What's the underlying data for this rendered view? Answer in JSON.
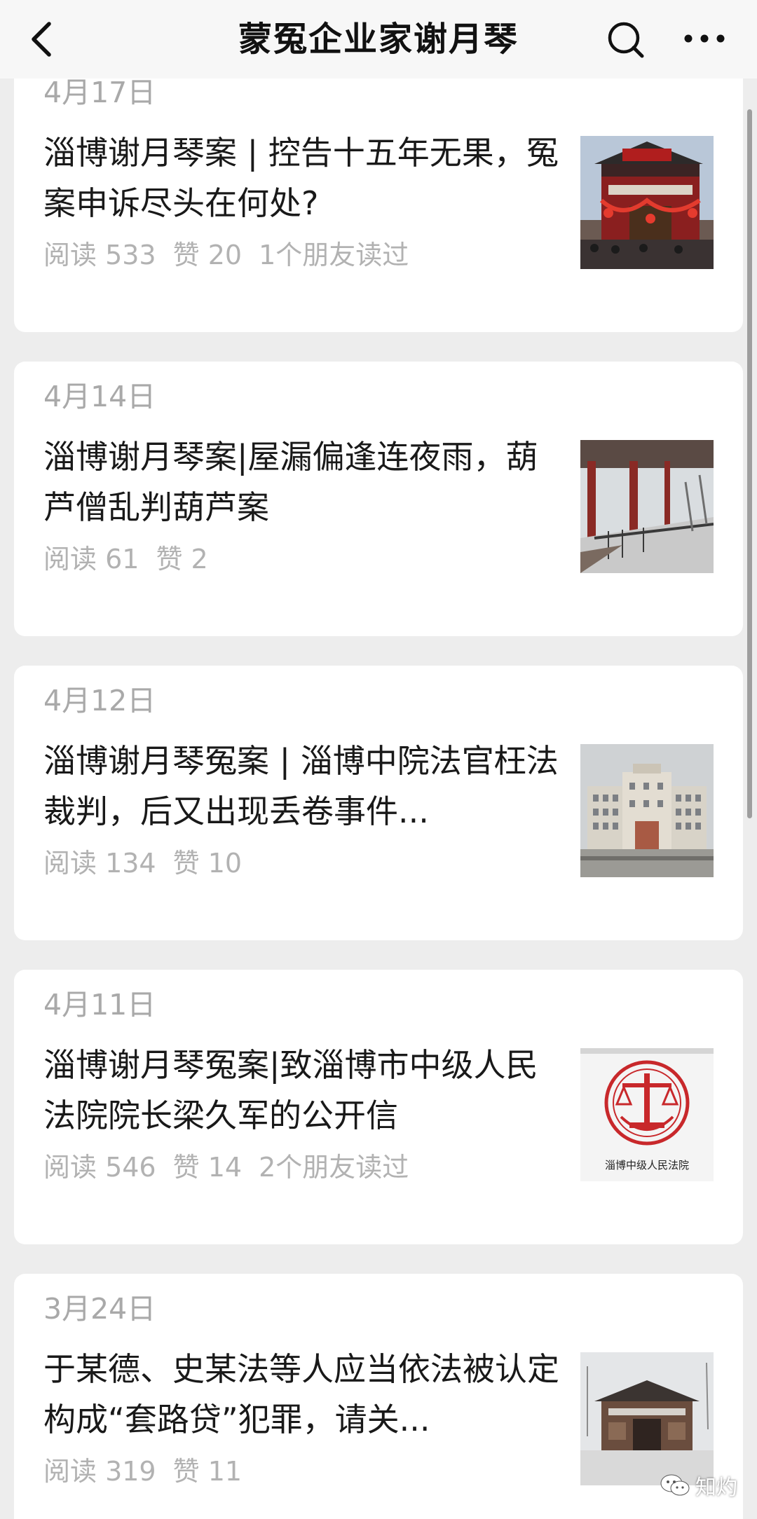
{
  "header": {
    "title": "蒙冤企业家谢月琴",
    "back_icon": "chevron-left-icon",
    "search_icon": "search-icon",
    "more_icon": "more-dots-icon"
  },
  "articles": [
    {
      "date": "4月17日",
      "title": "淄博谢月琴案 | 控告十五年无果，冤案申诉尽头在何处?",
      "reads": "阅读 533",
      "likes": "赞 20",
      "friends": "1个朋友读过",
      "thumb": "temple-gate-thumbnail"
    },
    {
      "date": "4月14日",
      "title": "淄博谢月琴案|屋漏偏逢连夜雨，葫芦僧乱判葫芦案",
      "reads": "阅读 61",
      "likes": "赞 2",
      "friends": "",
      "thumb": "snowy-corridor-thumbnail"
    },
    {
      "date": "4月12日",
      "title": "淄博谢月琴冤案 | 淄博中院法官枉法裁判，后又出现丢卷事件...",
      "reads": "阅读 134",
      "likes": "赞 10",
      "friends": "",
      "thumb": "court-building-thumbnail"
    },
    {
      "date": "4月11日",
      "title": "淄博谢月琴冤案|致淄博市中级人民法院院长梁久军的公开信",
      "reads": "阅读 546",
      "likes": "赞 14",
      "friends": "2个朋友读过",
      "thumb": "court-emblem-thumbnail",
      "thumb_caption": "淄博中级人民法院"
    },
    {
      "date": "3月24日",
      "title": "于某德、史某法等人应当依法被认定构成“套路贷”犯罪，请关...",
      "reads": "阅读 319",
      "likes": "赞 11",
      "friends": "",
      "thumb": "old-building-thumbnail"
    }
  ],
  "watermark": {
    "text": "知灼",
    "icon": "wechat-icon"
  },
  "colors": {
    "background": "#ededed",
    "card": "#ffffff",
    "meta_text": "#a9a9a9",
    "title_text": "#191919",
    "emblem_red": "#c8282b"
  }
}
